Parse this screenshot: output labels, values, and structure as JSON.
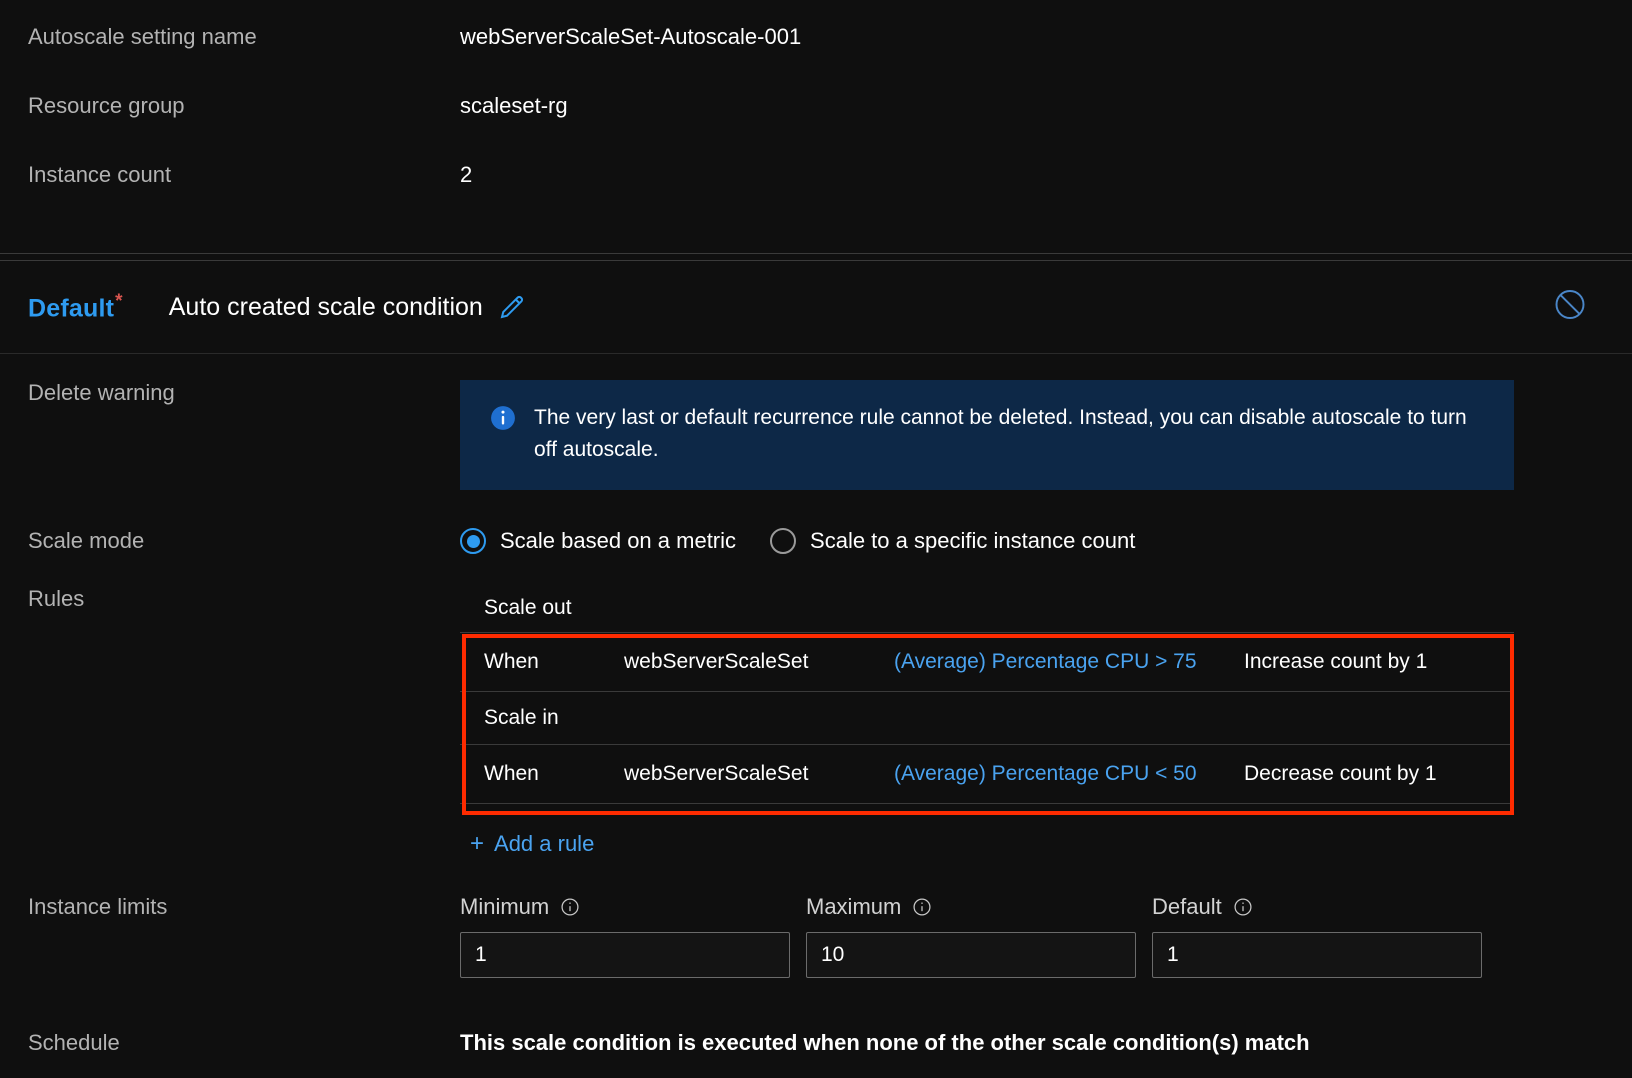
{
  "summary": {
    "rows": [
      {
        "label": "Autoscale setting name",
        "value": "webServerScaleSet-Autoscale-001"
      },
      {
        "label": "Resource group",
        "value": "scaleset-rg"
      },
      {
        "label": "Instance count",
        "value": "2"
      }
    ]
  },
  "condition": {
    "default_label": "Default",
    "required_marker": "*",
    "name": "Auto created scale condition",
    "edit_icon": "pencil-icon",
    "disable_icon": "disable-block-icon"
  },
  "fields": {
    "delete_warning_label": "Delete warning",
    "scale_mode_label": "Scale mode",
    "rules_label": "Rules",
    "instance_limits_label": "Instance limits",
    "schedule_label": "Schedule"
  },
  "banner": {
    "icon": "info-icon",
    "text": "The very last or default recurrence rule cannot be deleted. Instead, you can disable autoscale to turn off autoscale.",
    "background": "#0d2847"
  },
  "scale_mode": {
    "options": [
      {
        "label": "Scale based on a metric",
        "selected": true
      },
      {
        "label": "Scale to a specific instance count",
        "selected": false
      }
    ]
  },
  "rules": {
    "scale_out_title": "Scale out",
    "scale_in_title": "Scale in",
    "scale_out_rule": {
      "when": "When",
      "resource": "webServerScaleSet",
      "metric": "(Average) Percentage CPU > 75",
      "action": "Increase count by 1"
    },
    "scale_in_rule": {
      "when": "When",
      "resource": "webServerScaleSet",
      "metric": "(Average) Percentage CPU < 50",
      "action": "Decrease count by 1"
    },
    "add_rule_label": "Add a rule",
    "add_rule_plus": "+",
    "highlight_color": "#fe2b00"
  },
  "instance_limits": {
    "minimum": {
      "label": "Minimum",
      "value": "1"
    },
    "maximum": {
      "label": "Maximum",
      "value": "10"
    },
    "default": {
      "label": "Default",
      "value": "1"
    }
  },
  "schedule": {
    "text": "This scale condition is executed when none of the other scale condition(s) match"
  },
  "colors": {
    "accent_blue": "#2e9bf0",
    "link_blue": "#4aa3f0",
    "required_red": "#d9554f",
    "highlight_red": "#fe2b00",
    "page_bg": "#0f0f0f"
  }
}
